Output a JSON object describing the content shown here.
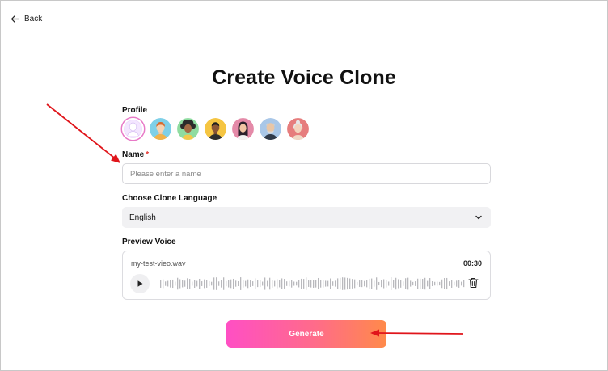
{
  "nav": {
    "back_label": "Back"
  },
  "page": {
    "title": "Create Voice Clone"
  },
  "profile": {
    "label": "Profile",
    "avatars": [
      {
        "name": "avatar-default",
        "bg": "#f3e6ff",
        "selected": true
      },
      {
        "name": "avatar-ginger-boy",
        "bg": "#7fd0e8"
      },
      {
        "name": "avatar-curly-girl",
        "bg": "#8fdca0"
      },
      {
        "name": "avatar-dark-man",
        "bg": "#f5c542"
      },
      {
        "name": "avatar-long-hair-woman",
        "bg": "#e48aa8"
      },
      {
        "name": "avatar-bald-man",
        "bg": "#a9c7e8"
      },
      {
        "name": "avatar-old-woman",
        "bg": "#e67d7d"
      }
    ]
  },
  "name_field": {
    "label": "Name",
    "required_mark": "*",
    "placeholder": "Please enter a name",
    "value": ""
  },
  "language": {
    "label": "Choose Clone Language",
    "selected": "English"
  },
  "preview": {
    "label": "Preview Voice",
    "filename": "my-test-vieo.wav",
    "duration": "00:30"
  },
  "actions": {
    "generate_label": "Generate"
  },
  "colors": {
    "arrow": "#e0151b",
    "gradient_start": "#ff4fc4",
    "gradient_end": "#ff8a4a",
    "required": "#e53935"
  }
}
